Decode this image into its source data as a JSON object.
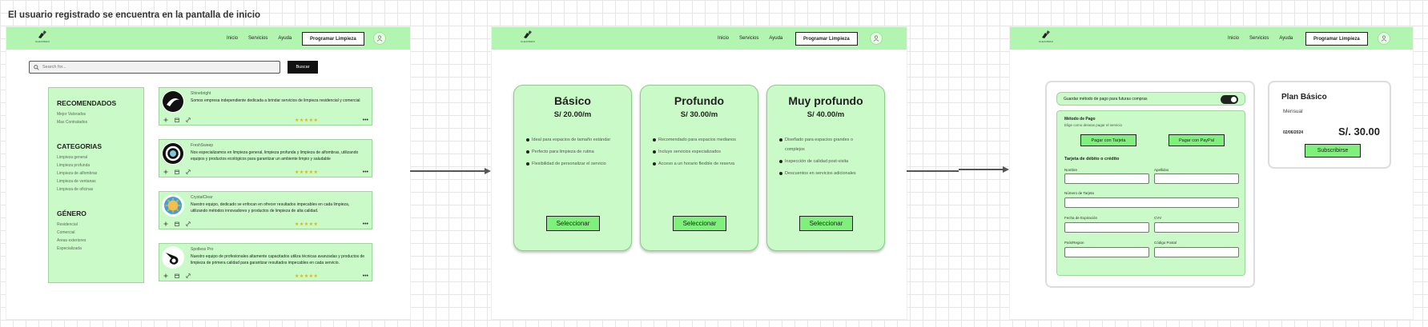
{
  "caption": "El usuario registrado se encuentra en la pantalla de inicio",
  "nav": {
    "brand": "CLEANMAX",
    "links": [
      "Inicio",
      "Servicios",
      "Ayuda"
    ],
    "cta": "Programar Limpieza",
    "icons": [
      "broom-logo-icon",
      "user-avatar-icon"
    ]
  },
  "screen1": {
    "search": {
      "placeholder": "Search for...",
      "button": "Buscar"
    },
    "sidebar": [
      {
        "title": "RECOMENDADOS",
        "items": [
          "Mejor Valorados",
          "Mas Contratados"
        ]
      },
      {
        "title": "CATEGORIAS",
        "items": [
          "Limpieza general",
          "Limpieza profunda",
          "Limpieza de alfombras",
          "Limpieza de ventanas",
          "Limpieza de oficinas"
        ]
      },
      {
        "title": "GÉNERO",
        "items": [
          "Residencial",
          "Comercial",
          "Areas exteriores",
          "Especializada"
        ]
      }
    ],
    "companies": [
      {
        "name": "Shinebright",
        "description": "Somos empresa independiente dedicada a brindar servicios de limpieza residencial y comercial",
        "rating": "★★★★★",
        "logo": "shine-logo-icon"
      },
      {
        "name": "FreshSweep",
        "description": "Nos especializamos en limpieza general, limpieza profunda y limpieza de alfombras, utilizando equipos y productos ecológicos para garantizar un ambiente limpio y saludable",
        "rating": "★★★★★",
        "logo": "swirl-logo-icon"
      },
      {
        "name": "CrystalClear",
        "description": "Nuestro equipo, dedicado se enfocan en ofrecer resultados impecables en cada limpieza, utilizando métodos innovadores y productos de limpieza de alta calidad.",
        "rating": "★★★★★",
        "logo": "crystal-logo-icon"
      },
      {
        "name": "Spotless Pro",
        "description": "Nuestro equipo de profesionales altamente capacitados utiliza técnicas avanzadas y productos de limpieza de primera calidad para garantizar resultados impecables en cada servicio.",
        "rating": "★★★★★",
        "logo": "spotless-logo-icon"
      }
    ],
    "more": "•••"
  },
  "screen2": {
    "plans": [
      {
        "title": "Básico",
        "price": "S/ 20.00/m",
        "features": [
          "Ideal para espacios de tamaño estándar",
          "Perfecto para limpieza de rutina",
          "Flexibilidad de personalizar el servicio"
        ],
        "button": "Seleccionar"
      },
      {
        "title": "Profundo",
        "price": "S/ 30.00/m",
        "features": [
          "Recomendado para espacios medianos",
          "Incluye servicios especializados",
          "Acceso a un horario flexible de reserva"
        ],
        "button": "Seleccionar"
      },
      {
        "title": "Muy profundo",
        "price": "S/ 40.00/m",
        "features": [
          "Diseñado para espacios grandes o complejos",
          "Inspección de calidad post-visita",
          "Descuentos en servicios adicionales"
        ],
        "button": "Seleccionar"
      }
    ]
  },
  "screen3": {
    "save_label": "Guardar método de pago para futuras compras",
    "method_title": "Método de Pago",
    "method_sub": "Elige como deseas pagar el servicio",
    "pay_card": "Pagar con Tarjeta",
    "pay_paypal": "Pagar con PayPal",
    "card_title": "Tarjeta de débito o crédito",
    "fields": {
      "nombre": "Nombre",
      "apellidos": "Apellidos",
      "numero": "Número de Tarjeta",
      "expiracion": "Fecha de Expiración",
      "cvv": "CVV",
      "pais": "País/Region",
      "postal": "Código Postal"
    },
    "summary": {
      "title": "Plan Básico",
      "frequency": "Mensual",
      "date": "02/06/2024",
      "price": "S/. 30.00",
      "button": "Subscribirse"
    }
  }
}
